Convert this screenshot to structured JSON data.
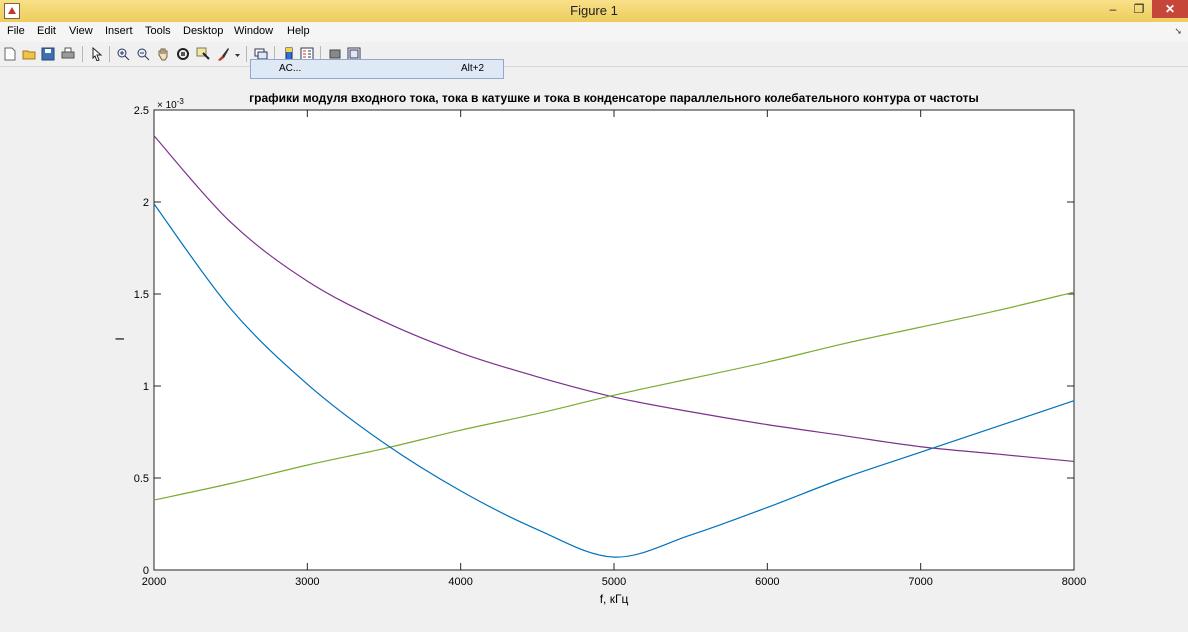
{
  "window": {
    "title": "Figure 1",
    "minimize": "–",
    "restore": "❐",
    "close": "✕"
  },
  "menu": [
    "File",
    "Edit",
    "View",
    "Insert",
    "Tools",
    "Desktop",
    "Window",
    "Help"
  ],
  "toolbar": {
    "icons": [
      "new-figure-icon",
      "open-file-icon",
      "save-icon",
      "print-icon",
      "pointer-icon",
      "zoom-in-icon",
      "zoom-out-icon",
      "pan-icon",
      "rotate-3d-icon",
      "data-cursor-icon",
      "brush-icon",
      "brush-dropdown-icon",
      "link-plot-icon",
      "insert-colorbar-icon",
      "insert-legend-icon",
      "hide-plot-tools-icon",
      "show-plot-tools-icon"
    ]
  },
  "popup": {
    "label": "AC...",
    "shortcut": "Alt+2"
  },
  "chart_data": {
    "type": "line",
    "title": "графики модуля входного тока, тока в катушке и тока в конденсаторе параллельного колебательного контура от частоты",
    "xlabel": "f, кГц",
    "ylabel": "I",
    "xlim": [
      2000,
      8000
    ],
    "ylim": [
      0,
      0.0025
    ],
    "x_ticks": [
      2000,
      3000,
      4000,
      5000,
      6000,
      7000,
      8000
    ],
    "y_ticks": [
      0,
      0.0005,
      0.001,
      0.0015,
      0.002,
      0.0025
    ],
    "y_tick_labels": [
      "0",
      "0.5",
      "1",
      "1.5",
      "2",
      "2.5"
    ],
    "y_exponent": {
      "base": "× 10",
      "power": "-3"
    },
    "grid": false,
    "series": [
      {
        "color": "#7E2F8E",
        "x": [
          2000,
          2500,
          3000,
          3500,
          4000,
          4500,
          5000,
          5500,
          6000,
          6500,
          7000,
          7500,
          8000
        ],
        "y": [
          0.00236,
          0.00189,
          0.00157,
          0.00135,
          0.00118,
          0.00105,
          0.00094,
          0.00086,
          0.00079,
          0.00073,
          0.00067,
          0.00063,
          0.00059
        ]
      },
      {
        "color": "#77AC30",
        "x": [
          2000,
          2500,
          3000,
          3500,
          4000,
          4500,
          5000,
          5500,
          6000,
          6500,
          7000,
          7500,
          8000
        ],
        "y": [
          0.00038,
          0.00047,
          0.00057,
          0.00066,
          0.00076,
          0.00085,
          0.00095,
          0.00104,
          0.00113,
          0.00123,
          0.00132,
          0.00141,
          0.00151
        ]
      },
      {
        "color": "#0072BD",
        "x": [
          2000,
          2500,
          3000,
          3500,
          4000,
          4500,
          5000,
          5500,
          6000,
          6500,
          7000,
          7500,
          8000
        ],
        "y": [
          0.00199,
          0.00142,
          0.00101,
          0.00069,
          0.00043,
          0.00022,
          7e-05,
          0.00019,
          0.00034,
          0.0005,
          0.00064,
          0.00078,
          0.00092
        ]
      }
    ]
  }
}
